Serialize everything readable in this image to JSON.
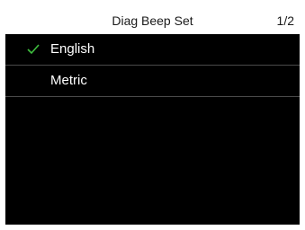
{
  "header": {
    "title": "Diag Beep Set",
    "page_indicator": "1/2"
  },
  "menu": {
    "items": [
      {
        "label": "English",
        "selected": true,
        "icon": "checkmark-icon"
      },
      {
        "label": "Metric",
        "selected": false
      }
    ]
  },
  "colors": {
    "background": "#000000",
    "title_bar": "#ffffff",
    "check_green": "#3fbf3f",
    "divider": "#4a4a4a"
  }
}
